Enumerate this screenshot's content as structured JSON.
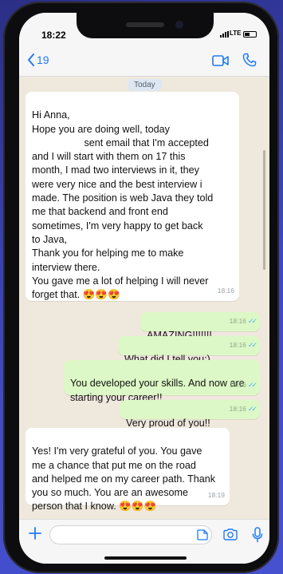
{
  "status_bar": {
    "time": "18:22",
    "network": "LTE"
  },
  "header": {
    "back_count": "19",
    "icons": [
      "chevron-left-icon",
      "video-icon",
      "phone-icon"
    ]
  },
  "chat": {
    "date_label": "Today",
    "messages": [
      {
        "direction": "in",
        "text_part1": "Hi Anna,\nHope you are doing well, today\n",
        "text_part2": " sent email that I'm accepted\nand I will start with them on 17 this\nmonth, I mad two interviews in it, they\nwere very nice and the best interview i\nmade. The position is web Java they told\nme that backend and front end\nsometimes, I'm very happy to get back\nto Java,\nThank you for helping me to make\ninterview there.\nYou gave me a lot of helping I will never\nforget that. 😍😍😍",
        "time": "18:16"
      },
      {
        "direction": "out",
        "text": "AMAZING!!!!!!!",
        "time": "18:16"
      },
      {
        "direction": "out",
        "text": "What did I tell you;)",
        "time": "18:16"
      },
      {
        "direction": "out",
        "text": "You developed your skills. And now are\nstarting your career!!",
        "time": "18:16"
      },
      {
        "direction": "out",
        "text": "Very proud of you!!",
        "time": "18:16"
      },
      {
        "direction": "in",
        "text": "Yes! I'm very grateful of you. You gave\nme a chance that put me on the road\nand helped me on my career path. Thank\nyou so much. You are an awesome\nperson that I know. 😍😍😍",
        "time": "18:19"
      }
    ]
  },
  "composer": {
    "placeholder": "",
    "icons": [
      "plus-icon",
      "sticker-icon",
      "camera-icon",
      "microphone-icon"
    ]
  },
  "colors": {
    "accent": "#1f7bf2",
    "outgoing_bubble": "#dcf8c6",
    "incoming_bubble": "#ffffff",
    "read_ticks": "#4fb6ec",
    "background": "#3b45b8"
  }
}
